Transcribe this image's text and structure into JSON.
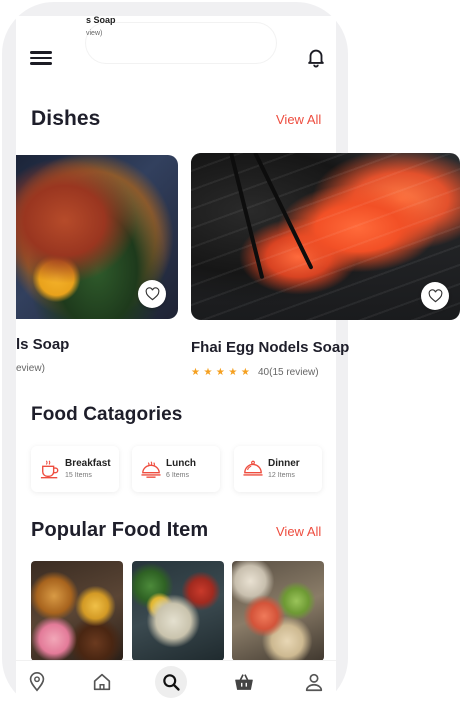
{
  "ghost_header": {
    "title": "s Soap",
    "subtitle": "view)"
  },
  "dishes": {
    "title": "Dishes",
    "view_all": "View All",
    "items": [
      {
        "name": "ls Soap",
        "review_text": "eview)"
      },
      {
        "name": "Fhai Egg Nodels Soap",
        "stars": "★★★★★",
        "review_text": "40(15 review)"
      }
    ]
  },
  "categories": {
    "title": "Food Catagories",
    "items": [
      {
        "name": "Breakfast",
        "count": "15 Items",
        "icon": "coffee-cup-icon"
      },
      {
        "name": "Lunch",
        "count": "6 Items",
        "icon": "food-tray-icon"
      },
      {
        "name": "Dinner",
        "count": "12 Items",
        "icon": "cloche-icon"
      }
    ]
  },
  "popular": {
    "title": "Popular Food Item",
    "view_all": "View All"
  },
  "bottom_nav": {
    "items": [
      "location-pin-icon",
      "home-icon",
      "search-icon",
      "basket-icon",
      "profile-icon"
    ]
  },
  "colors": {
    "accent": "#ee4d3f",
    "star": "#f5a020",
    "text": "#1e1e2a"
  }
}
